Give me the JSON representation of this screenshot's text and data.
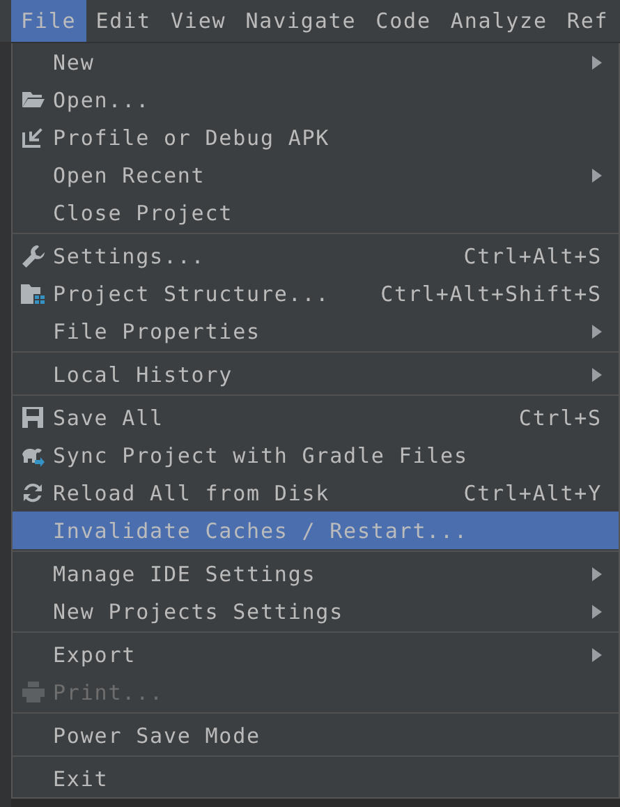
{
  "menu_bar": [
    {
      "label": "File",
      "selected": true
    },
    {
      "label": "Edit",
      "selected": false
    },
    {
      "label": "View",
      "selected": false
    },
    {
      "label": "Navigate",
      "selected": false
    },
    {
      "label": "Code",
      "selected": false
    },
    {
      "label": "Analyze",
      "selected": false
    },
    {
      "label": "Ref",
      "selected": false
    }
  ],
  "file_menu": [
    [
      {
        "label": "New",
        "kind": "plain",
        "submenu": true,
        "selected": false,
        "disabled": false
      },
      {
        "label": "Open...",
        "kind": "folder",
        "submenu": false,
        "selected": false,
        "disabled": false
      },
      {
        "label": "Profile or Debug APK",
        "kind": "import",
        "submenu": false,
        "selected": false,
        "disabled": false
      },
      {
        "label": "Open Recent",
        "kind": "plain",
        "submenu": true,
        "selected": false,
        "disabled": false
      },
      {
        "label": "Close Project",
        "kind": "plain",
        "submenu": false,
        "selected": false,
        "disabled": false
      }
    ],
    [
      {
        "label": "Settings...",
        "kind": "wrench",
        "shortcut": "Ctrl+Alt+S",
        "submenu": false,
        "selected": false,
        "disabled": false
      },
      {
        "label": "Project Structure...",
        "kind": "structure",
        "shortcut": "Ctrl+Alt+Shift+S",
        "submenu": false,
        "selected": false,
        "disabled": false
      },
      {
        "label": "File Properties",
        "kind": "plain",
        "submenu": true,
        "selected": false,
        "disabled": false
      }
    ],
    [
      {
        "label": "Local History",
        "kind": "plain",
        "submenu": true,
        "selected": false,
        "disabled": false
      }
    ],
    [
      {
        "label": "Save All",
        "kind": "floppy",
        "shortcut": "Ctrl+S",
        "submenu": false,
        "selected": false,
        "disabled": false
      },
      {
        "label": "Sync Project with Gradle Files",
        "kind": "sync",
        "submenu": false,
        "selected": false,
        "disabled": false
      },
      {
        "label": "Reload All from Disk",
        "kind": "reload",
        "shortcut": "Ctrl+Alt+Y",
        "submenu": false,
        "selected": false,
        "disabled": false
      },
      {
        "label": "Invalidate Caches / Restart...",
        "kind": "plain",
        "submenu": false,
        "selected": true,
        "disabled": false
      }
    ],
    [
      {
        "label": "Manage IDE Settings",
        "kind": "plain",
        "submenu": true,
        "selected": false,
        "disabled": false
      },
      {
        "label": "New Projects Settings",
        "kind": "plain",
        "submenu": true,
        "selected": false,
        "disabled": false
      }
    ],
    [
      {
        "label": "Export",
        "kind": "plain",
        "submenu": true,
        "selected": false,
        "disabled": false
      },
      {
        "label": "Print...",
        "kind": "printer",
        "submenu": false,
        "selected": false,
        "disabled": true
      }
    ],
    [
      {
        "label": "Power Save Mode",
        "kind": "plain",
        "submenu": false,
        "selected": false,
        "disabled": false
      }
    ],
    [
      {
        "label": "Exit",
        "kind": "plain",
        "submenu": false,
        "selected": false,
        "disabled": false
      }
    ]
  ]
}
